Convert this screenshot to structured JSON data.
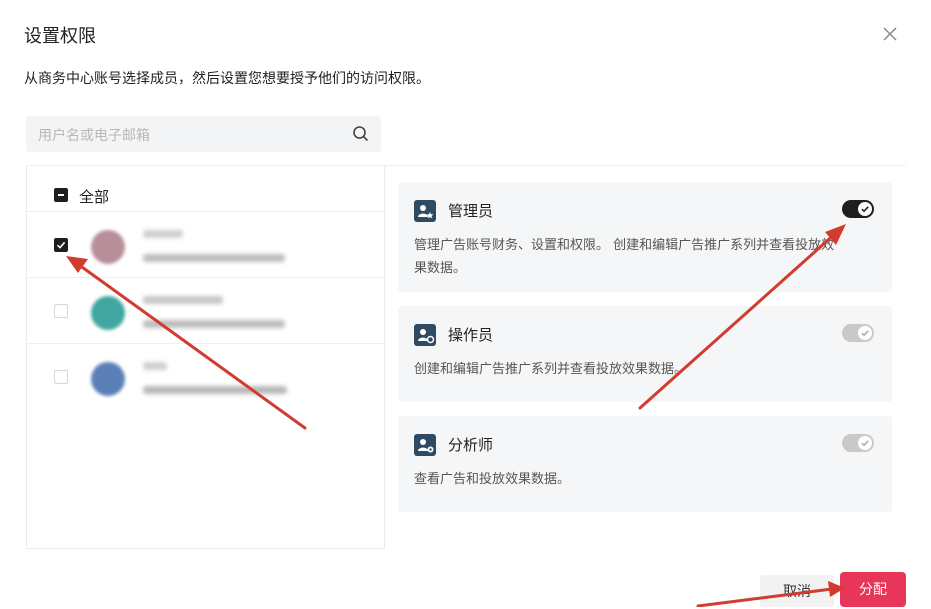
{
  "dialog": {
    "title": "设置权限",
    "subtitle": "从商务中心账号选择成员，然后设置您想要授予他们的访问权限。",
    "close_icon": "close-icon"
  },
  "search": {
    "placeholder": "用户名或电子邮箱",
    "icon": "search-icon"
  },
  "members": {
    "select_all_label": "全部",
    "select_all_state": "indeterminate",
    "rows": [
      {
        "checked": true,
        "avatar_color": "#b88f99"
      },
      {
        "checked": false,
        "avatar_color": "#3fa7a0"
      },
      {
        "checked": false,
        "avatar_color": "#5b7fb8"
      }
    ]
  },
  "roles": [
    {
      "name": "管理员",
      "description": "管理广告账号财务、设置和权限。 创建和编辑广告推广系列并查看投放效果数据。",
      "enabled": true
    },
    {
      "name": "操作员",
      "description": "创建和编辑广告推广系列并查看投放效果数据。",
      "enabled": false
    },
    {
      "name": "分析师",
      "description": "查看广告和投放效果数据。",
      "enabled": false
    }
  ],
  "footer": {
    "cancel_label": "取消",
    "assign_label": "分配"
  },
  "colors": {
    "accent": "#e8355a",
    "toggle_on": "#1e1e1e",
    "toggle_off": "#c9c9c9",
    "annotation_arrow": "#d23b2f"
  }
}
